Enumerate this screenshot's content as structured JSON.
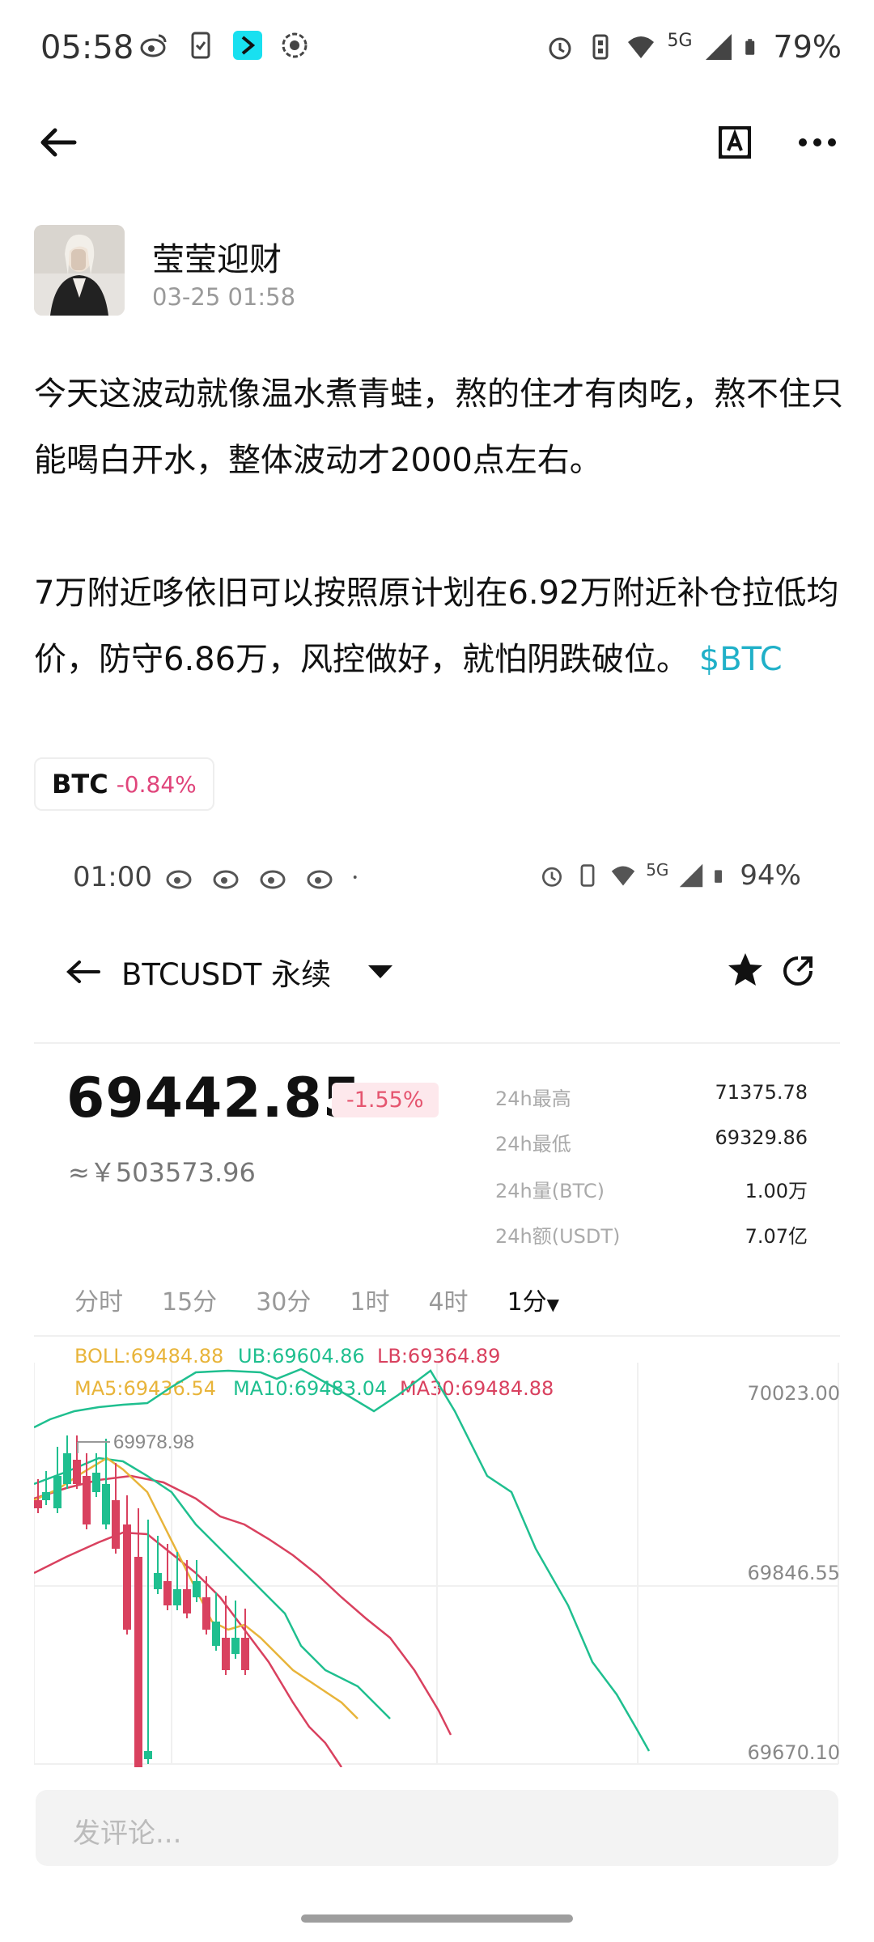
{
  "status_bar": {
    "time": "05:58",
    "network": "5G",
    "battery": "79%"
  },
  "author": {
    "name": "莹莹迎财",
    "time": "03-25 01:58"
  },
  "post": {
    "paragraph1": "今天这波动就像温水煮青蛙，熬的住才有肉吃，熬不住只能喝白开水，整体波动才2000点左右。",
    "paragraph2": "7万附近哆依旧可以按照原计划在6.92万附近补仓拉低均价，防守6.86万，风控做好，就怕阴跌破位。",
    "hashtag": "$BTC"
  },
  "coin_chip": {
    "symbol": "BTC",
    "change": "-0.84%"
  },
  "embedded": {
    "status_time": "01:00",
    "status_network": "5G",
    "status_battery": "94%",
    "pair": "BTCUSDT 永续",
    "price": "69442.85",
    "change": "-1.55%",
    "cny": "≈￥503573.96",
    "stats": [
      {
        "label": "24h最高",
        "value": "71375.78"
      },
      {
        "label": "24h最低",
        "value": "69329.86"
      },
      {
        "label": "24h量(BTC)",
        "value": "1.00万"
      },
      {
        "label": "24h额(USDT)",
        "value": "7.07亿"
      }
    ],
    "tabs": [
      "分时",
      "15分",
      "30分",
      "1时",
      "4时",
      "1分"
    ],
    "indicators": {
      "boll": "BOLL:69484.88",
      "ub": "UB:69604.86",
      "lb": "LB:69364.89",
      "ma5": "MA5:69436.54",
      "ma10": "MA10:69483.04",
      "ma30": "MA30:69484.88"
    },
    "high_marker": "69978.98",
    "y_ticks": [
      "70023.00",
      "69846.55",
      "69670.10"
    ]
  },
  "comment_placeholder": "发评论...",
  "colors": {
    "up": "#1fbf8f",
    "down": "#d9415f",
    "link": "#20b0c8"
  }
}
